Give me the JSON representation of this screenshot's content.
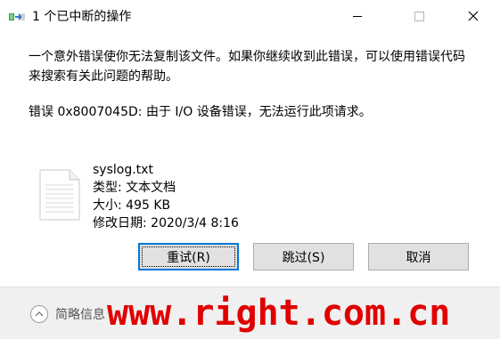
{
  "window": {
    "title": "1 个已中断的操作"
  },
  "message": {
    "main": "一个意外错误使你无法复制该文件。如果你继续收到此错误，可以使用错误代码来搜索有关此问题的帮助。",
    "detail": "错误 0x8007045D: 由于 I/O 设备错误，无法运行此项请求。"
  },
  "file": {
    "name": "syslog.txt",
    "type": "类型: 文本文档",
    "size": "大小: 495 KB",
    "modified": "修改日期: 2020/3/4 8:16"
  },
  "buttons": {
    "retry": "重试(R)",
    "skip": "跳过(S)",
    "cancel": "取消"
  },
  "footer": {
    "details_label": "简略信息",
    "watermark": "www.right.com.cn"
  },
  "colors": {
    "focus_border": "#0078d7",
    "watermark": "#e00000"
  }
}
